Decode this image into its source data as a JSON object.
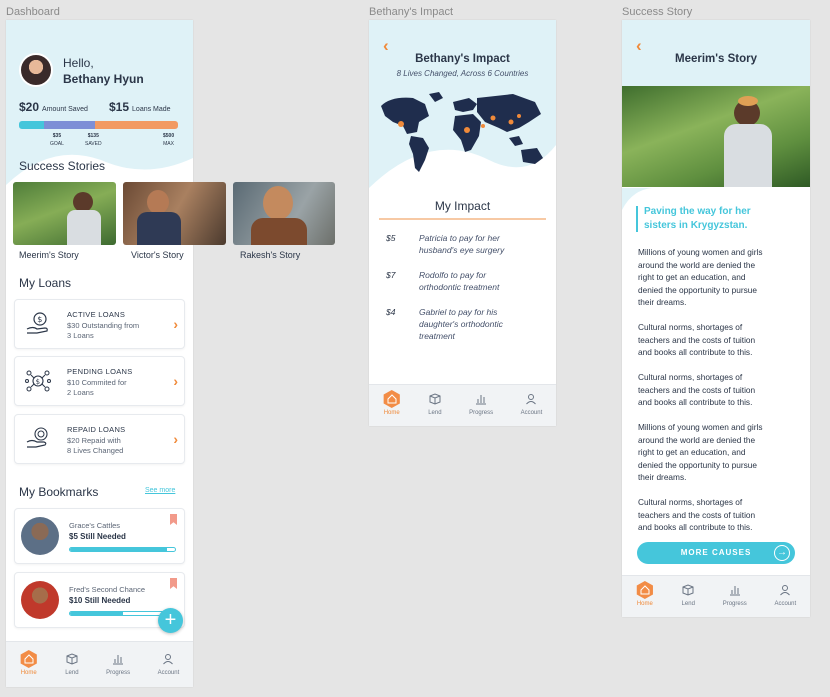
{
  "frames": {
    "dashboard": "Dashboard",
    "impact": "Bethany's Impact",
    "story": "Success Story"
  },
  "colors": {
    "accent": "#f08a3a",
    "teal": "#45c6db",
    "navy": "#1f2d4d",
    "tealbg": "#dff2f7",
    "periwinkle": "#7e8fd6"
  },
  "nav": [
    {
      "label": "Home",
      "icon": "home-icon"
    },
    {
      "label": "Lend",
      "icon": "lend-icon"
    },
    {
      "label": "Progress",
      "icon": "progress-icon"
    },
    {
      "label": "Account",
      "icon": "account-icon"
    }
  ],
  "dashboard": {
    "greeting": "Hello,",
    "name": "Bethany Hyun",
    "saved_amount": "$20",
    "saved_label": "Amount Saved",
    "loans_amount": "$15",
    "loans_label": "Loans Made",
    "progress": {
      "goal_value": "$35",
      "goal_label": "GOAL",
      "saved_value": "$135",
      "saved_label": "SAVED",
      "max_value": "$500",
      "max_label": "MAX"
    },
    "success_title": "Success Stories",
    "stories": [
      {
        "label": "Meerim's Story"
      },
      {
        "label": "Victor's Story"
      },
      {
        "label": "Rakesh's Story"
      }
    ],
    "loans_title": "My Loans",
    "loans": [
      {
        "title": "ACTIVE LOANS",
        "line1": "$30 Outstanding from",
        "line2": "3 Loans",
        "icon": "hand-money-icon"
      },
      {
        "title": "PENDING LOANS",
        "line1": "$10 Commited for",
        "line2": "2 Loans",
        "icon": "network-dollar-icon"
      },
      {
        "title": "REPAID LOANS",
        "line1": "$20 Repaid with",
        "line2": "8 Lives Changed",
        "icon": "hand-coins-icon"
      }
    ],
    "bookmarks_title": "My Bookmarks",
    "see_more": "See more",
    "bookmarks": [
      {
        "title": "Grace's Cattles",
        "needed": "$5 Still Needed",
        "progress": 0.92
      },
      {
        "title": "Fred's Second Chance",
        "needed": "$10 Still Needed",
        "progress": 0.5
      }
    ]
  },
  "impact": {
    "title": "Bethany's Impact",
    "subtitle": "8 Lives Changed, Across 6 Countries",
    "section_title": "My Impact",
    "items": [
      {
        "amount": "$5",
        "text1": "Patricia to pay for her",
        "text2": "husband's eye surgery",
        "text3": ""
      },
      {
        "amount": "$7",
        "text1": "Rodolfo to pay for",
        "text2": "orthodontic treatment",
        "text3": ""
      },
      {
        "amount": "$4",
        "text1": "Gabriel to pay for his",
        "text2": "daughter's orthodontic",
        "text3": "treatment"
      }
    ]
  },
  "story": {
    "title": "Meerim's Story",
    "quote1": "Paving the way for her",
    "quote2": "sisters in Krygyzstan.",
    "paragraphs": [
      [
        "Millions of young women and girls",
        "around the world are denied the",
        "right to get an education, and",
        "denied the opportunity to pursue",
        "their dreams."
      ],
      [
        "Cultural norms, shortages of",
        "teachers and the costs of tuition",
        "and books all contribute to this."
      ],
      [
        "Cultural norms, shortages of",
        "teachers and the costs of tuition",
        "and books all contribute to this."
      ],
      [
        "Millions of young women and girls",
        "around the world are denied the",
        "right to get an education, and",
        "denied the opportunity to pursue",
        "their dreams."
      ],
      [
        "Cultural norms, shortages of",
        "teachers and the costs of tuition",
        "and books all contribute to this."
      ]
    ],
    "cta": "MORE CAUSES"
  }
}
